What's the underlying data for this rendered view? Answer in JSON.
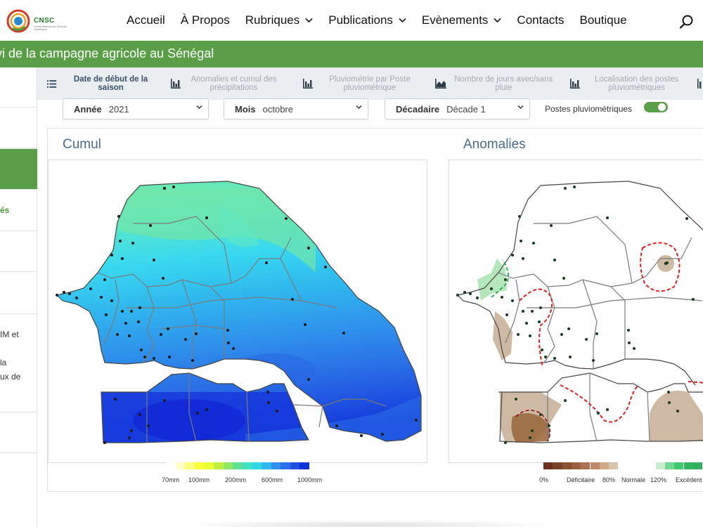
{
  "header": {
    "logo_text": "CNSC",
    "logo_subtext": "Centre National des Services Climatiques",
    "nav": [
      {
        "label": "Accueil",
        "dropdown": false
      },
      {
        "label": "À Propos",
        "dropdown": false
      },
      {
        "label": "Rubriques",
        "dropdown": true
      },
      {
        "label": "Publications",
        "dropdown": true
      },
      {
        "label": "Evènements",
        "dropdown": true
      },
      {
        "label": "Contacts",
        "dropdown": false
      },
      {
        "label": "Boutique",
        "dropdown": false
      }
    ]
  },
  "banner": {
    "title": "vi de la campagne agricole au Sénégal"
  },
  "sidebar": {
    "items": [
      "",
      "",
      "",
      "és",
      "",
      "IM et",
      "la",
      "ux de",
      ""
    ]
  },
  "tabs": [
    {
      "label": "Date de début de la saison",
      "active": true,
      "icon": "list-icon"
    },
    {
      "label": "Anomalies et cumul des précipitations",
      "active": false,
      "icon": "bar-chart-icon"
    },
    {
      "label": "Pluviométrie par Poste pluviométrique",
      "active": false,
      "icon": "bar-chart-icon"
    },
    {
      "label": "Nombre de jours avec/sans pluie",
      "active": false,
      "icon": "area-chart-icon"
    },
    {
      "label": "Localisation des postes pluviométriques",
      "active": false,
      "icon": "bar-chart-icon"
    }
  ],
  "filters": {
    "year": {
      "label": "Année",
      "value": "2021"
    },
    "month": {
      "label": "Mois",
      "value": "octobre"
    },
    "dekad": {
      "label": "Décadaire",
      "value": "Décade 1"
    },
    "stations_toggle": {
      "label": "Postes pluviométriques",
      "on": true
    }
  },
  "cumul": {
    "title": "Cumul",
    "legend_colors": [
      "#ffffff",
      "#ffffc8",
      "#ffff80",
      "#ffff40",
      "#e8ff30",
      "#c0f040",
      "#90e860",
      "#60e090",
      "#40e0c0",
      "#30d8e8",
      "#30b8f0",
      "#3090f0",
      "#2a70e8",
      "#2050e0",
      "#1030d8"
    ],
    "legend_labels": [
      "70mm",
      "100mm",
      "200mm",
      "600mm",
      "1000mm"
    ]
  },
  "anomalies": {
    "title": "Anomalies",
    "legend_colors": [
      "#6b3020",
      "#7a4028",
      "#8a5030",
      "#9a6040",
      "#ab7050",
      "#bd8a66",
      "#cfa886",
      "#dcc4a8",
      "#ffffff",
      "#ffffff",
      "#ffffff",
      "#ffffff",
      "#c8ecd0",
      "#70d890",
      "#40c870",
      "#30b860",
      "#30b060"
    ],
    "legend_labels": [
      "0%",
      "Déficitaire",
      "80%",
      "Normale",
      "120%",
      "Excédent"
    ]
  }
}
